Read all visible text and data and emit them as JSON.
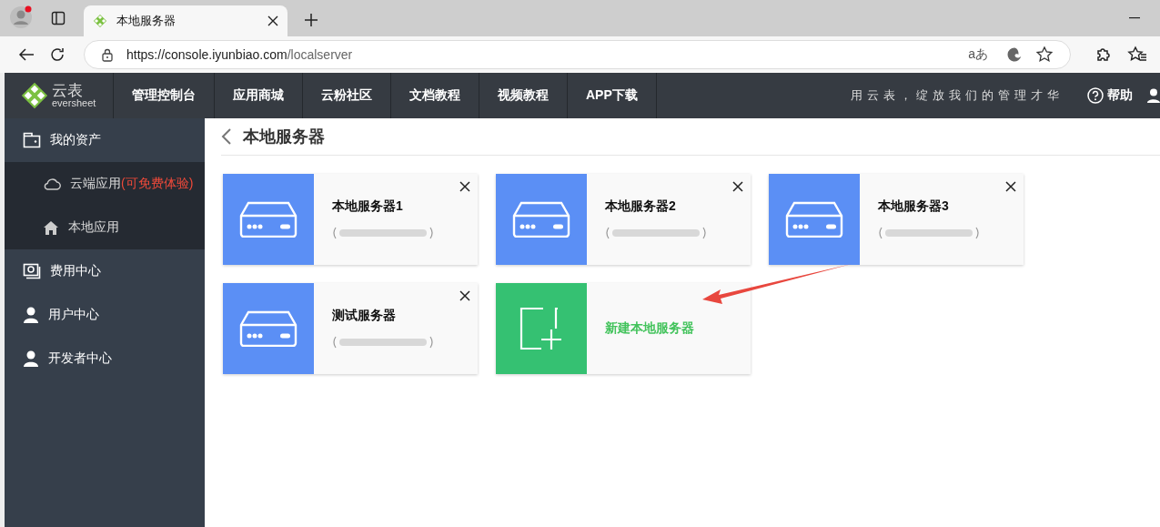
{
  "browser": {
    "tab_title": "本地服务器",
    "url_host": "https://console.iyunbiao.com",
    "url_path": "/localserver",
    "read_aloud_label": "aあ"
  },
  "header": {
    "logo_text": "云表",
    "logo_sub": "eversheet",
    "nav": [
      "管理控制台",
      "应用商城",
      "云粉社区",
      "文档教程",
      "视频教程",
      "APP下载"
    ],
    "slogan": "用云表，绽放我们的管理才华",
    "help": "帮助"
  },
  "sidebar": [
    {
      "label": "我的资产",
      "kind": "wallet",
      "expanded": true,
      "children": [
        {
          "label": "云端应用",
          "note": "(可免费体验)",
          "kind": "cloud"
        },
        {
          "label": "本地应用",
          "kind": "home"
        }
      ]
    },
    {
      "label": "费用中心",
      "kind": "bill",
      "expanded": false
    },
    {
      "label": "用户中心",
      "kind": "user",
      "expanded": false
    },
    {
      "label": "开发者中心",
      "kind": "user",
      "expanded": false
    }
  ],
  "page_title": "本地服务器",
  "cards": [
    {
      "kind": "server",
      "title": "本地服务器1"
    },
    {
      "kind": "server",
      "title": "本地服务器2"
    },
    {
      "kind": "server",
      "title": "本地服务器3"
    },
    {
      "kind": "server",
      "title": "测试服务器"
    },
    {
      "kind": "new",
      "title": "新建本地服务器"
    }
  ]
}
